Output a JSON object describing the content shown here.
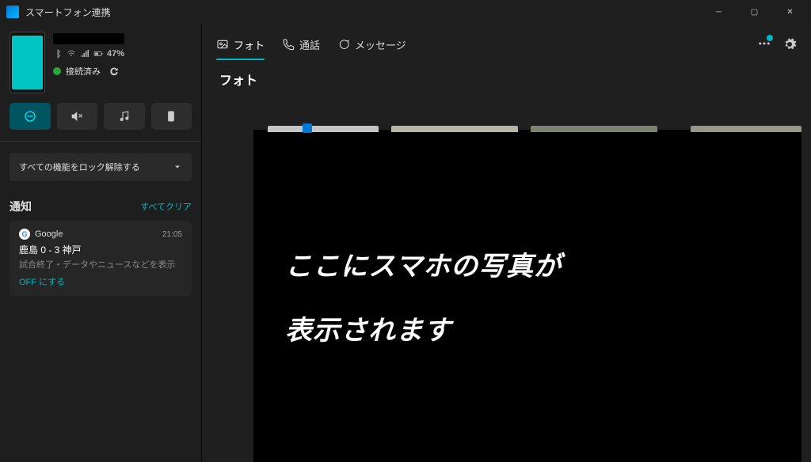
{
  "window": {
    "title": "スマートフォン連携"
  },
  "device": {
    "battery": "47%",
    "connection_status": "接続済み"
  },
  "sidebar": {
    "unlock_label": "すべての機能をロック解除する",
    "notifications_heading": "通知",
    "clear_all_label": "すべてクリア"
  },
  "notification": {
    "app": "Google",
    "time": "21:05",
    "title": "鹿島 0 - 3 神戸",
    "body": "試合終了・データやニュースなどを表示",
    "action": "OFF にする"
  },
  "tabs": {
    "photos": "フォト",
    "calls": "通話",
    "messages": "メッセージ"
  },
  "main": {
    "section_title": "フォト",
    "overlay_line1": "ここにスマホの写真が",
    "overlay_line2": "表示されます"
  }
}
